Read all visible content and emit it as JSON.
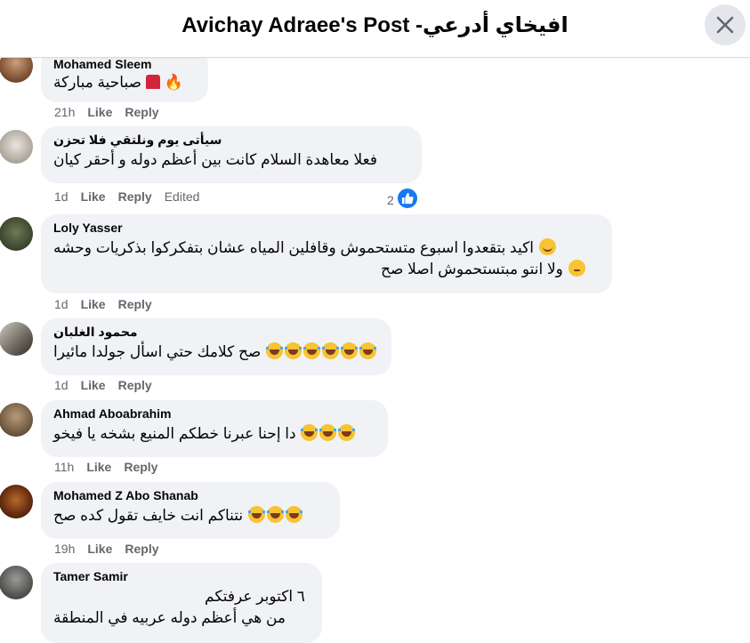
{
  "header": {
    "title": "Avichay Adraee's Post -افيخاي أدرعي",
    "close_icon": "close-icon"
  },
  "comments": [
    {
      "author": "Mohamed Sleem",
      "text": "صباحية مباركة",
      "emojis": [
        "fez",
        "fire"
      ],
      "time": "21h",
      "like": "Like",
      "reply": "Reply"
    },
    {
      "author": "سيأتى يوم ونلتقي فلا تحزن",
      "text": "فعلا معاهدة السلام كانت بين أعظم دوله و أحقر كيان",
      "time": "1d",
      "like": "Like",
      "reply": "Reply",
      "edited": "Edited",
      "reaction_count": "2"
    },
    {
      "author": "Loly Yasser",
      "text_line1": "اكيد بتقعدوا اسبوع متستحموش وقافلين المياه عشان بتفكركوا بذكريات وحشه",
      "text_line2": "ولا انتو مبتستحموش اصلا صح",
      "time": "1d",
      "like": "Like",
      "reply": "Reply"
    },
    {
      "author": "محمود الغلبان",
      "text": "صح كلامك حتي اسأل جولدا مائيرا",
      "time": "1d",
      "like": "Like",
      "reply": "Reply"
    },
    {
      "author": "Ahmad Aboabrahim",
      "text": "دا إحنا عبرنا خطكم المنيع بشخه يا فيخو",
      "time": "11h",
      "like": "Like",
      "reply": "Reply"
    },
    {
      "author": "Mohamed Z Abo Shanab",
      "text": "نتناكم انت خايف تقول كده صح",
      "time": "19h",
      "like": "Like",
      "reply": "Reply"
    },
    {
      "author": "Tamer Samir",
      "text_line1": "٦ اكتوبر عرفتكم",
      "text_line2": "من هي أعظم دوله عربيه في المنطقة"
    }
  ],
  "colors": {
    "bubble": "#f0f2f5",
    "meta": "#65676b",
    "like_blue": "#1877f2"
  }
}
